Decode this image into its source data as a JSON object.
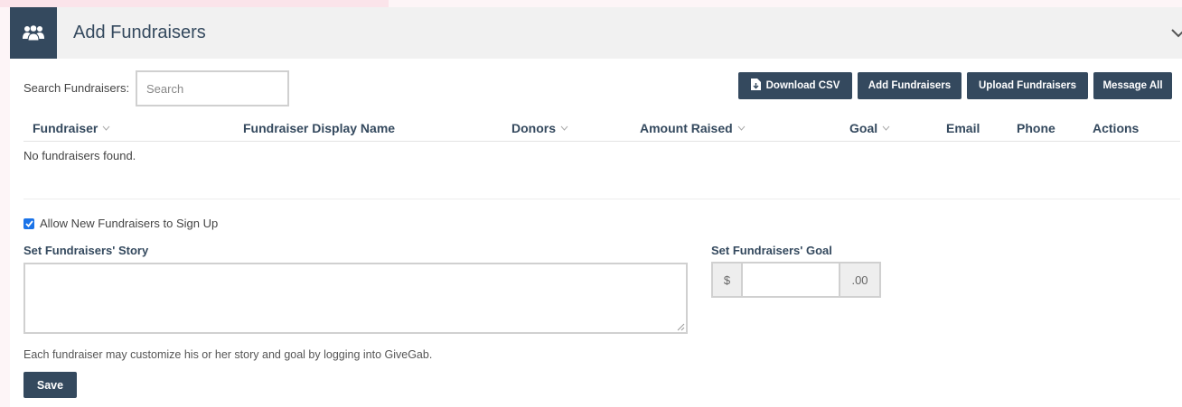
{
  "panel": {
    "title": "Add Fundraisers",
    "header_icon": "users-icon",
    "collapse_icon": "chevron-down-icon"
  },
  "search": {
    "label": "Search Fundraisers:",
    "placeholder": "Search",
    "value": ""
  },
  "toolbar": {
    "download_csv": "Download CSV",
    "download_icon": "file-download-icon",
    "add_fundraisers": "Add Fundraisers",
    "upload_fundraisers": "Upload Fundraisers",
    "message_all": "Message All"
  },
  "table": {
    "columns": [
      {
        "label": "Fundraiser",
        "sortable": true
      },
      {
        "label": "Fundraiser Display Name",
        "sortable": false
      },
      {
        "label": "Donors",
        "sortable": true
      },
      {
        "label": "Amount Raised",
        "sortable": true
      },
      {
        "label": "Goal",
        "sortable": true
      },
      {
        "label": "Email",
        "sortable": false
      },
      {
        "label": "Phone",
        "sortable": false
      },
      {
        "label": "Actions",
        "sortable": false
      }
    ],
    "empty_message": "No fundraisers found."
  },
  "settings": {
    "allow_signup_label": "Allow New Fundraisers to Sign Up",
    "allow_signup_checked": true,
    "story_label": "Set Fundraisers' Story",
    "story_value": "",
    "goal_label": "Set Fundraisers' Goal",
    "goal_prefix": "$",
    "goal_suffix": ".00",
    "goal_value": "",
    "help_text": "Each fundraiser may customize his or her story and goal by logging into GiveGab.",
    "save_label": "Save"
  },
  "colors": {
    "primary": "#34495e",
    "header_bg": "#f1f1f1",
    "checkbox": "#1a73e8",
    "page_bg": "#fdf5f7"
  }
}
